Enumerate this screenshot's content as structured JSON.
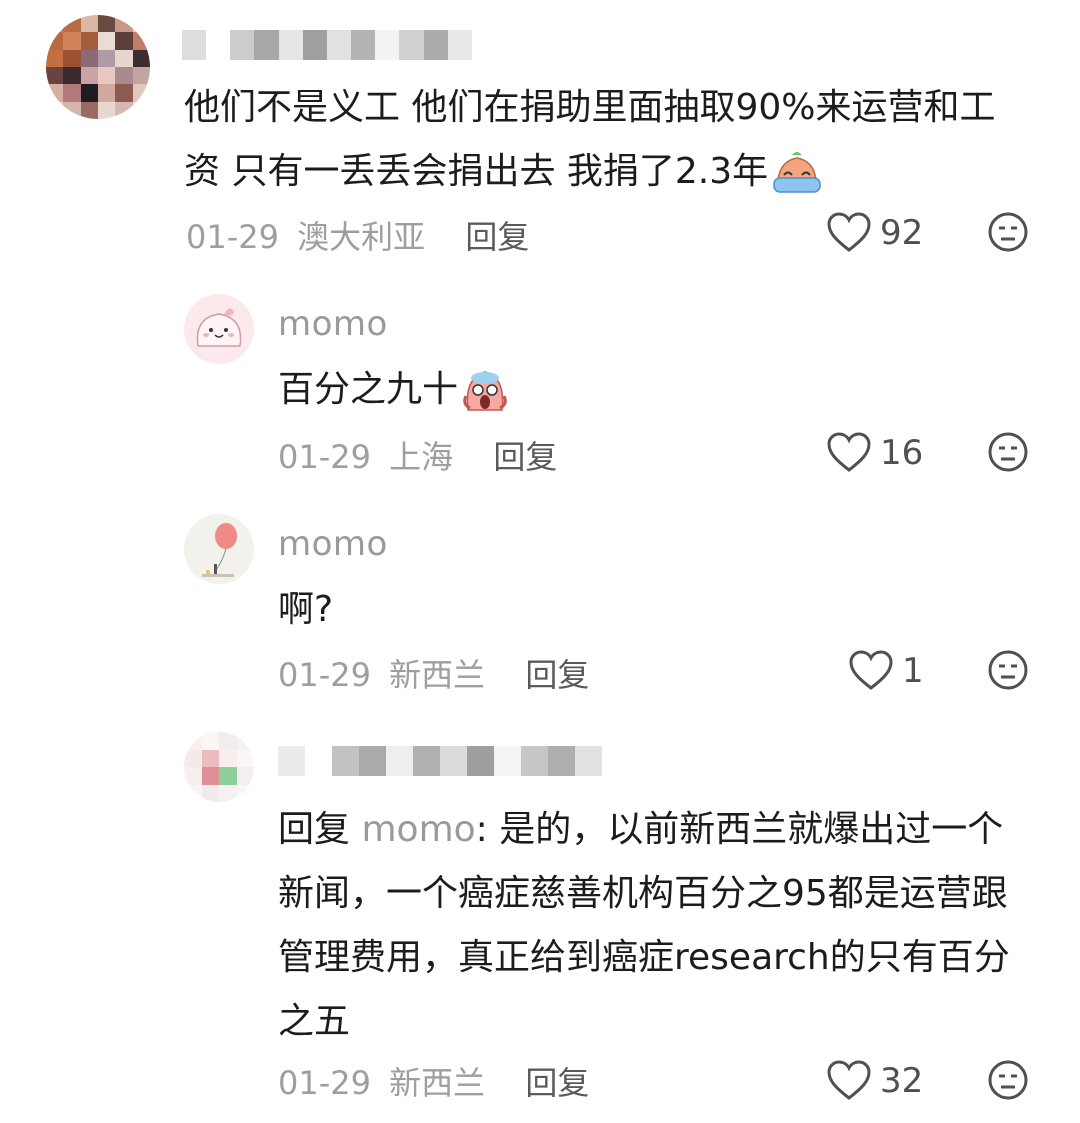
{
  "comments": [
    {
      "text": "他们不是义工 他们在捐助里面抽取90%来运营和工资 只有一丢丢会捐出去 我捐了2.3年",
      "date": "01-29",
      "location": "澳大利亚",
      "reply_label": "回复",
      "likes": "92"
    }
  ],
  "replies": [
    {
      "name": "momo",
      "text": "百分之九十",
      "date": "01-29",
      "location": "上海",
      "reply_label": "回复",
      "likes": "16"
    },
    {
      "name": "momo",
      "text": "啊?",
      "date": "01-29",
      "location": "新西兰",
      "reply_label": "回复",
      "likes": "1"
    },
    {
      "reply_prefix": "回复",
      "mention": "momo",
      "text": ": 是的，以前新西兰就爆出过一个新闻，一个癌症慈善机构百分之95都是运营跟管理费用，真正给到癌症research的只有百分之五",
      "date": "01-29",
      "location": "新西兰",
      "reply_label": "回复",
      "likes": "32"
    }
  ],
  "icons": {
    "like": "heart-outline-icon",
    "dislike": "unamused-face-icon",
    "emoji_1": "crying-emoji",
    "emoji_2": "screaming-emoji"
  },
  "colors": {
    "muted": "#9e9e9e",
    "text": "#1c1c1c",
    "icon": "#505050"
  }
}
